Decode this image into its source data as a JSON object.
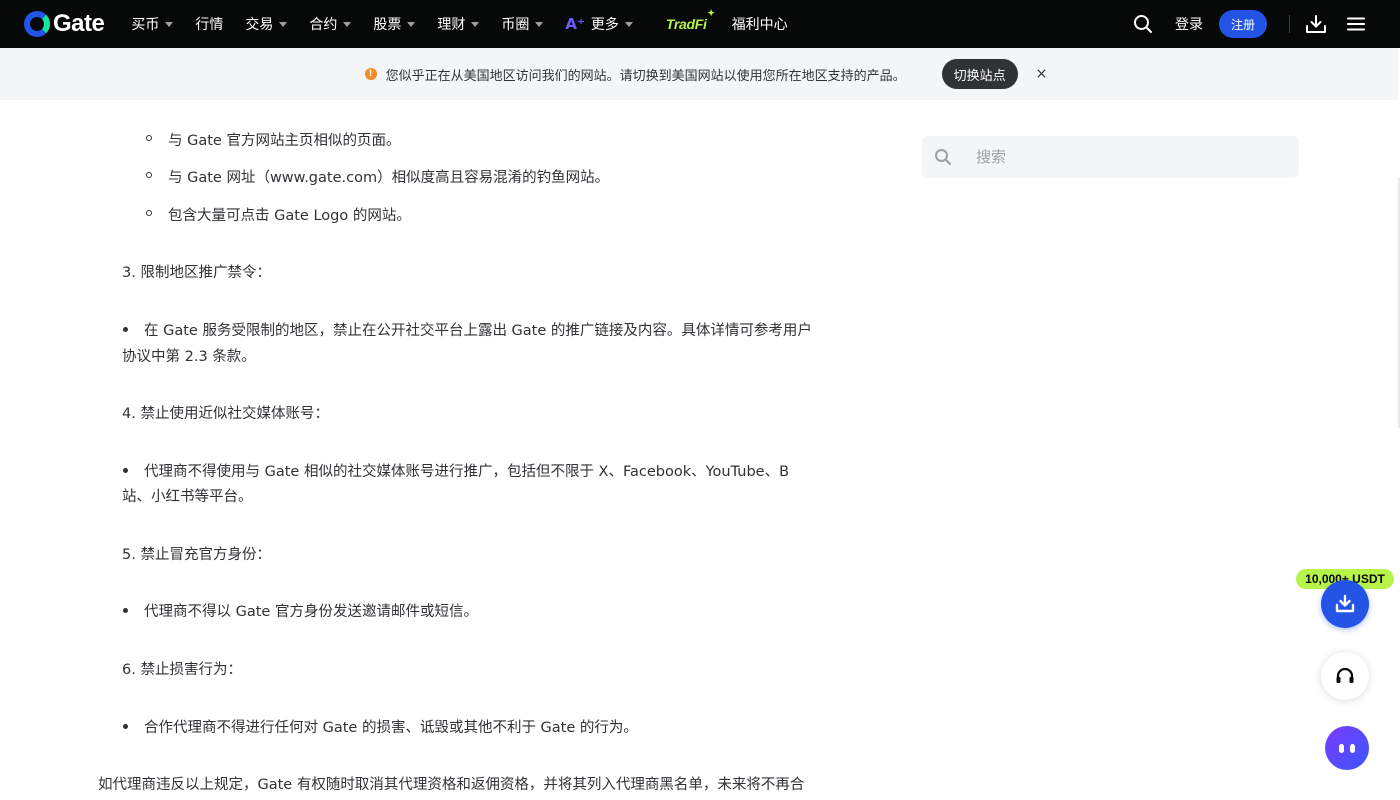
{
  "nav": {
    "logo_text": "Gate",
    "items": [
      {
        "label": "买币",
        "has_caret": true
      },
      {
        "label": "行情",
        "has_caret": false
      },
      {
        "label": "交易",
        "has_caret": true
      },
      {
        "label": "合约",
        "has_caret": true
      },
      {
        "label": "股票",
        "has_caret": true
      },
      {
        "label": "理财",
        "has_caret": true
      },
      {
        "label": "币圈",
        "has_caret": true
      }
    ],
    "more_label": "更多",
    "more_icon": "ai-icon",
    "tradfi_label": "TradFi",
    "welfare_label": "福利中心",
    "login_label": "登录",
    "register_label": "注册",
    "right_icons": [
      "search-icon",
      "download-icon",
      "menu-icon"
    ]
  },
  "banner": {
    "icon": "warning-icon",
    "text": "您似乎正在从美国地区访问我们的网站。请切换到美国网站以使用您所在地区支持的产品。",
    "switch_label": "切换站点",
    "close_label": "×"
  },
  "article": {
    "sub_bullets": [
      "与 Gate 官方网站主页相似的页面。",
      "与 Gate 网址（www.gate.com）相似度高且容易混淆的钓鱼网站。",
      "包含大量可点击 Gate Logo 的网站。"
    ],
    "sections": [
      {
        "heading": "3. 限制地区推广禁令：",
        "bullet_line1": "在 Gate 服务受限制的地区，禁止在公开社交平台上露出 Gate 的推广链接及内容。具体详情可参考用户",
        "bullet_line2": "协议中第 2.3 条款。"
      },
      {
        "heading": "4. 禁止使用近似社交媒体账号：",
        "bullet_line1": "代理商不得使用与 Gate 相似的社交媒体账号进行推广，包括但不限于 X、Facebook、YouTube、B",
        "bullet_line2": "站、小红书等平台。"
      },
      {
        "heading": "5. 禁止冒充官方身份：",
        "bullet_line1": "代理商不得以 Gate 官方身份发送邀请邮件或短信。",
        "bullet_line2": ""
      },
      {
        "heading": "6. 禁止损害行为：",
        "bullet_line1": "合作代理商不得进行任何对 Gate 的损害、诋毁或其他不利于 Gate 的行为。",
        "bullet_line2": ""
      }
    ],
    "closing": "如代理商违反以上规定，Gate 有权随时取消其代理资格和返佣资格，并将其列入代理商黑名单，未来将不再合"
  },
  "sidebar": {
    "search_placeholder": "搜索"
  },
  "floating": {
    "promo_badge": "10,000+ USDT",
    "download_icon": "download-icon",
    "support_icon": "headset-icon",
    "bot_icon": "chatbot-icon"
  },
  "colors": {
    "nav_bg": "#070808",
    "brand_blue": "#2354e6",
    "accent_green": "#b7f34a",
    "warning": "#f28c28"
  }
}
